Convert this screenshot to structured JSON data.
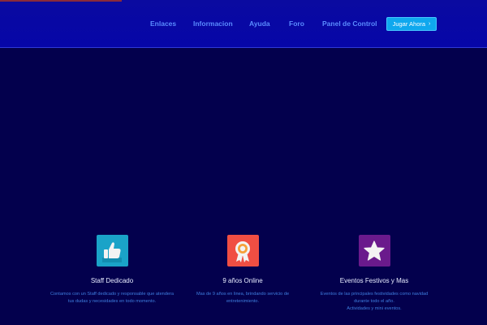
{
  "nav": {
    "items": [
      "Enlaces",
      "Informacion",
      "Ayuda",
      "Foro",
      "Panel de Control"
    ],
    "cta_label": "Jugar Ahora",
    "cta_arrow": "›"
  },
  "features": [
    {
      "icon": "thumbs-up-icon",
      "icon_color": "#1aa3c8",
      "title": "Staff Dedicado",
      "desc_lines": [
        "Contamos con un Staff dedicado y responsable que atendera",
        "tus dudas y necesidades en todo momento."
      ]
    },
    {
      "icon": "award-ribbon-icon",
      "icon_color": "#f04e43",
      "title": "9 años Online",
      "desc_lines": [
        "Mas de 9 años en linea, brindando servicio de",
        "entretenimiento."
      ]
    },
    {
      "icon": "star-icon",
      "icon_color": "#6a1a8c",
      "title": "Eventos Festivos y Mas",
      "desc_lines": [
        "Eventos de las principales festividades como navidad",
        "durante todo el año.",
        "Actividades y mini eventos."
      ]
    }
  ],
  "colors": {
    "background": "#03004d",
    "topbar": "#0606a8",
    "nav_link": "#5a8cff",
    "cta": "#0fa8ee",
    "desc_text": "#3f7fe0"
  }
}
